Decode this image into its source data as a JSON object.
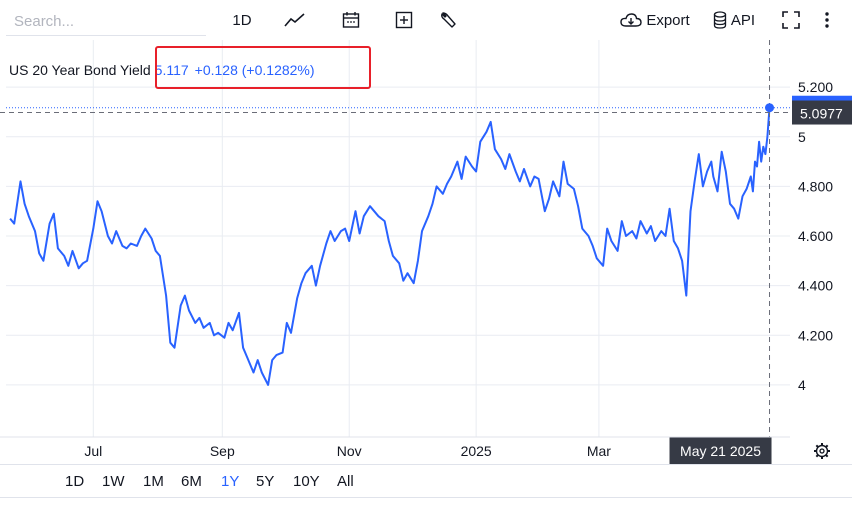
{
  "toolbar": {
    "search_placeholder": "Search...",
    "interval_label": "1D",
    "export_label": "Export",
    "api_label": "API"
  },
  "legend": {
    "symbol": "US 20 Year Bond Yield",
    "value": "5.117",
    "change": "+0.128 (+0.1282%)"
  },
  "crosshair": {
    "price_label": "5.0977",
    "date_label": "May 21 2025"
  },
  "ranges": [
    {
      "label": "1D",
      "active": false
    },
    {
      "label": "1W",
      "active": false
    },
    {
      "label": "1M",
      "active": false
    },
    {
      "label": "6M",
      "active": false
    },
    {
      "label": "1Y",
      "active": true
    },
    {
      "label": "5Y",
      "active": false
    },
    {
      "label": "10Y",
      "active": false
    },
    {
      "label": "All",
      "active": false
    }
  ],
  "colors": {
    "line": "#2962ff",
    "highlight": "#e8202a",
    "label_bg": "#363a45"
  },
  "chart_data": {
    "type": "line",
    "y_ticks": [
      {
        "value": 5.2,
        "label": "5.200"
      },
      {
        "value": 5.0,
        "label": "5"
      },
      {
        "value": 4.8,
        "label": "4.800"
      },
      {
        "value": 4.6,
        "label": "4.600"
      },
      {
        "value": 4.4,
        "label": "4.400"
      },
      {
        "value": 4.2,
        "label": "4.200"
      },
      {
        "value": 4.0,
        "label": "4"
      }
    ],
    "x_ticks": [
      {
        "date": "2024-07-01",
        "label": "Jul"
      },
      {
        "date": "2024-09-01",
        "label": "Sep"
      },
      {
        "date": "2024-11-01",
        "label": "Nov"
      },
      {
        "date": "2025-01-01",
        "label": "2025"
      },
      {
        "date": "2025-03-01",
        "label": "Mar"
      }
    ],
    "ylim": [
      3.79,
      5.39
    ],
    "xlim": [
      "2024-05-21",
      "2025-05-28"
    ],
    "last_value": 5.117,
    "crosshair_value": 5.0977,
    "grid": true,
    "series": [
      {
        "points": [
          [
            "2024-05-22",
            4.67
          ],
          [
            "2024-05-24",
            4.65
          ],
          [
            "2024-05-27",
            4.82
          ],
          [
            "2024-05-29",
            4.73
          ],
          [
            "2024-05-31",
            4.68
          ],
          [
            "2024-06-03",
            4.62
          ],
          [
            "2024-06-05",
            4.53
          ],
          [
            "2024-06-07",
            4.5
          ],
          [
            "2024-06-10",
            4.65
          ],
          [
            "2024-06-12",
            4.69
          ],
          [
            "2024-06-14",
            4.55
          ],
          [
            "2024-06-17",
            4.52
          ],
          [
            "2024-06-19",
            4.48
          ],
          [
            "2024-06-21",
            4.54
          ],
          [
            "2024-06-24",
            4.47
          ],
          [
            "2024-06-26",
            4.49
          ],
          [
            "2024-06-28",
            4.5
          ],
          [
            "2024-07-01",
            4.63
          ],
          [
            "2024-07-03",
            4.74
          ],
          [
            "2024-07-05",
            4.7
          ],
          [
            "2024-07-08",
            4.6
          ],
          [
            "2024-07-10",
            4.57
          ],
          [
            "2024-07-12",
            4.62
          ],
          [
            "2024-07-15",
            4.56
          ],
          [
            "2024-07-17",
            4.55
          ],
          [
            "2024-07-19",
            4.57
          ],
          [
            "2024-07-22",
            4.56
          ],
          [
            "2024-07-24",
            4.6
          ],
          [
            "2024-07-26",
            4.63
          ],
          [
            "2024-07-29",
            4.59
          ],
          [
            "2024-07-31",
            4.54
          ],
          [
            "2024-08-02",
            4.52
          ],
          [
            "2024-08-05",
            4.36
          ],
          [
            "2024-08-07",
            4.17
          ],
          [
            "2024-08-09",
            4.15
          ],
          [
            "2024-08-12",
            4.32
          ],
          [
            "2024-08-14",
            4.36
          ],
          [
            "2024-08-16",
            4.3
          ],
          [
            "2024-08-19",
            4.25
          ],
          [
            "2024-08-21",
            4.27
          ],
          [
            "2024-08-23",
            4.23
          ],
          [
            "2024-08-26",
            4.25
          ],
          [
            "2024-08-28",
            4.2
          ],
          [
            "2024-08-30",
            4.21
          ],
          [
            "2024-09-02",
            4.19
          ],
          [
            "2024-09-04",
            4.25
          ],
          [
            "2024-09-06",
            4.22
          ],
          [
            "2024-09-09",
            4.29
          ],
          [
            "2024-09-11",
            4.15
          ],
          [
            "2024-09-13",
            4.11
          ],
          [
            "2024-09-16",
            4.05
          ],
          [
            "2024-09-18",
            4.1
          ],
          [
            "2024-09-20",
            4.05
          ],
          [
            "2024-09-23",
            4.0
          ],
          [
            "2024-09-25",
            4.1
          ],
          [
            "2024-09-27",
            4.12
          ],
          [
            "2024-09-30",
            4.13
          ],
          [
            "2024-10-02",
            4.25
          ],
          [
            "2024-10-04",
            4.21
          ],
          [
            "2024-10-07",
            4.35
          ],
          [
            "2024-10-09",
            4.41
          ],
          [
            "2024-10-11",
            4.45
          ],
          [
            "2024-10-14",
            4.48
          ],
          [
            "2024-10-16",
            4.4
          ],
          [
            "2024-10-18",
            4.48
          ],
          [
            "2024-10-21",
            4.57
          ],
          [
            "2024-10-23",
            4.62
          ],
          [
            "2024-10-25",
            4.58
          ],
          [
            "2024-10-28",
            4.62
          ],
          [
            "2024-10-30",
            4.63
          ],
          [
            "2024-11-01",
            4.58
          ],
          [
            "2024-11-04",
            4.7
          ],
          [
            "2024-11-06",
            4.61
          ],
          [
            "2024-11-08",
            4.68
          ],
          [
            "2024-11-11",
            4.72
          ],
          [
            "2024-11-13",
            4.7
          ],
          [
            "2024-11-15",
            4.68
          ],
          [
            "2024-11-18",
            4.66
          ],
          [
            "2024-11-20",
            4.58
          ],
          [
            "2024-11-22",
            4.52
          ],
          [
            "2024-11-25",
            4.49
          ],
          [
            "2024-11-27",
            4.42
          ],
          [
            "2024-11-29",
            4.45
          ],
          [
            "2024-12-02",
            4.41
          ],
          [
            "2024-12-04",
            4.5
          ],
          [
            "2024-12-06",
            4.62
          ],
          [
            "2024-12-09",
            4.68
          ],
          [
            "2024-12-11",
            4.73
          ],
          [
            "2024-12-13",
            4.8
          ],
          [
            "2024-12-16",
            4.77
          ],
          [
            "2024-12-18",
            4.81
          ],
          [
            "2024-12-20",
            4.84
          ],
          [
            "2024-12-23",
            4.9
          ],
          [
            "2024-12-25",
            4.83
          ],
          [
            "2024-12-27",
            4.92
          ],
          [
            "2024-12-30",
            4.88
          ],
          [
            "2025-01-01",
            4.86
          ],
          [
            "2025-01-03",
            4.98
          ],
          [
            "2025-01-06",
            5.02
          ],
          [
            "2025-01-08",
            5.06
          ],
          [
            "2025-01-10",
            4.95
          ],
          [
            "2025-01-13",
            4.91
          ],
          [
            "2025-01-15",
            4.87
          ],
          [
            "2025-01-17",
            4.93
          ],
          [
            "2025-01-20",
            4.86
          ],
          [
            "2025-01-22",
            4.82
          ],
          [
            "2025-01-24",
            4.87
          ],
          [
            "2025-01-27",
            4.8
          ],
          [
            "2025-01-29",
            4.84
          ],
          [
            "2025-01-31",
            4.83
          ],
          [
            "2025-02-03",
            4.7
          ],
          [
            "2025-02-05",
            4.75
          ],
          [
            "2025-02-07",
            4.82
          ],
          [
            "2025-02-10",
            4.76
          ],
          [
            "2025-02-12",
            4.9
          ],
          [
            "2025-02-14",
            4.81
          ],
          [
            "2025-02-17",
            4.79
          ],
          [
            "2025-02-19",
            4.72
          ],
          [
            "2025-02-21",
            4.63
          ],
          [
            "2025-02-24",
            4.6
          ],
          [
            "2025-02-26",
            4.56
          ],
          [
            "2025-02-28",
            4.51
          ],
          [
            "2025-03-03",
            4.48
          ],
          [
            "2025-03-05",
            4.63
          ],
          [
            "2025-03-07",
            4.58
          ],
          [
            "2025-03-10",
            4.54
          ],
          [
            "2025-03-12",
            4.66
          ],
          [
            "2025-03-14",
            4.6
          ],
          [
            "2025-03-17",
            4.62
          ],
          [
            "2025-03-19",
            4.59
          ],
          [
            "2025-03-21",
            4.66
          ],
          [
            "2025-03-24",
            4.61
          ],
          [
            "2025-03-26",
            4.64
          ],
          [
            "2025-03-28",
            4.58
          ],
          [
            "2025-03-31",
            4.62
          ],
          [
            "2025-04-02",
            4.6
          ],
          [
            "2025-04-04",
            4.71
          ],
          [
            "2025-04-06",
            4.58
          ],
          [
            "2025-04-08",
            4.55
          ],
          [
            "2025-04-10",
            4.5
          ],
          [
            "2025-04-12",
            4.36
          ],
          [
            "2025-04-14",
            4.7
          ],
          [
            "2025-04-16",
            4.82
          ],
          [
            "2025-04-18",
            4.93
          ],
          [
            "2025-04-20",
            4.8
          ],
          [
            "2025-04-22",
            4.86
          ],
          [
            "2025-04-24",
            4.9
          ],
          [
            "2025-04-25",
            4.84
          ],
          [
            "2025-04-27",
            4.78
          ],
          [
            "2025-04-29",
            4.94
          ],
          [
            "2025-05-01",
            4.86
          ],
          [
            "2025-05-03",
            4.73
          ],
          [
            "2025-05-05",
            4.71
          ],
          [
            "2025-05-07",
            4.67
          ],
          [
            "2025-05-09",
            4.76
          ],
          [
            "2025-05-11",
            4.79
          ],
          [
            "2025-05-13",
            4.84
          ],
          [
            "2025-05-14",
            4.78
          ],
          [
            "2025-05-15",
            4.9
          ],
          [
            "2025-05-16",
            4.88
          ],
          [
            "2025-05-17",
            4.98
          ],
          [
            "2025-05-18",
            4.9
          ],
          [
            "2025-05-19",
            4.96
          ],
          [
            "2025-05-20",
            4.93
          ],
          [
            "2025-05-21",
            5.0
          ],
          [
            "2025-05-22",
            5.117
          ]
        ]
      }
    ]
  }
}
